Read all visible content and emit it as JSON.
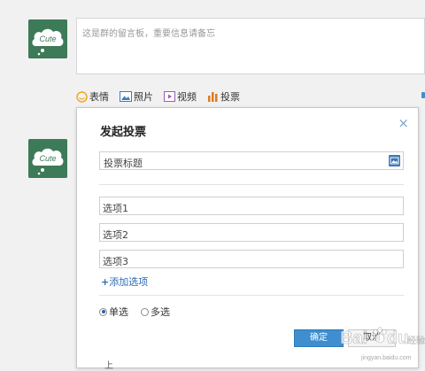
{
  "avatar_text": "Cute",
  "composer": {
    "placeholder": "这是群的留言板，重要信息请备忘"
  },
  "toolbar": [
    {
      "label": "表情",
      "icon": "smiley-icon",
      "color": "#f2a91b"
    },
    {
      "label": "照片",
      "icon": "photo-icon",
      "color": "#3a7cc4"
    },
    {
      "label": "视频",
      "icon": "video-icon",
      "color": "#9a5bb5"
    },
    {
      "label": "投票",
      "icon": "vote-icon",
      "color": "#e07b22"
    }
  ],
  "dialog": {
    "title": "发起投票",
    "close": "×",
    "poll_title_placeholder": "投票标题",
    "options": [
      "选项1",
      "选项2",
      "选项3"
    ],
    "add_option": "添加选项",
    "add_plus": "+",
    "modes": [
      {
        "label": "单选",
        "selected": true
      },
      {
        "label": "多选",
        "selected": false
      }
    ],
    "confirm": "确定",
    "cancel": "取消"
  },
  "watermark": {
    "brand": "Baidu",
    "sub": "经验",
    "url": "jingyan.baidu.com"
  },
  "colors": {
    "accent": "#3e8ed0",
    "link": "#2b6cb3",
    "avatar_bg": "#3d7a57"
  }
}
